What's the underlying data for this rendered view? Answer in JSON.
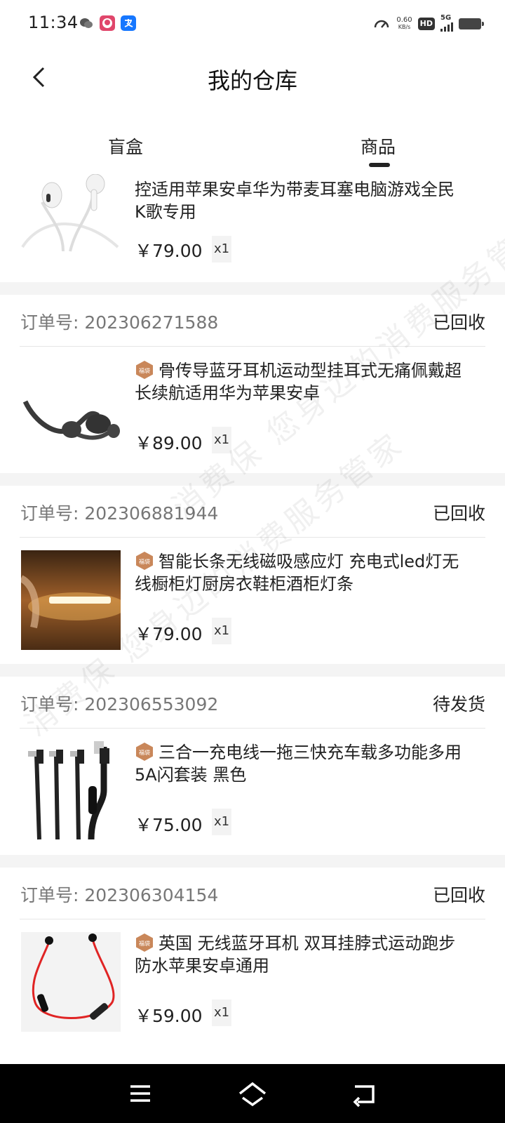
{
  "status_bar": {
    "time": "11:34",
    "net_speed_value": "0.60",
    "net_speed_unit": "KB/s",
    "hd_label": "HD",
    "signal_label": "5G"
  },
  "header": {
    "title": "我的仓库"
  },
  "tabs": [
    {
      "label": "盲盒",
      "active": false
    },
    {
      "label": "商品",
      "active": true
    }
  ],
  "orders": [
    {
      "order_label": "",
      "order_no": "",
      "status": "",
      "title": "控适用苹果安卓华为带麦耳塞电脑游戏全民K歌专用",
      "price": "￥79.00",
      "qty": "x1",
      "image": "earphones-icon",
      "tag": false
    },
    {
      "order_label": "订单号:",
      "order_no": "202306271588",
      "status": "已回收",
      "title": "骨传导蓝牙耳机运动型挂耳式无痛佩戴超长续航适用华为苹果安卓",
      "price": "￥89.00",
      "qty": "x1",
      "image": "bone-conduction-headset-icon",
      "tag": true
    },
    {
      "order_label": "订单号:",
      "order_no": "202306881944",
      "status": "已回收",
      "title": "智能长条无线磁吸感应灯 充电式led灯无线橱柜灯厨房衣鞋柜酒柜灯条",
      "price": "￥79.00",
      "qty": "x1",
      "image": "led-light-bar-icon",
      "tag": true
    },
    {
      "order_label": "订单号:",
      "order_no": "202306553092",
      "status": "待发货",
      "title": "三合一充电线一拖三快充车载多功能多用5A闪套装 黑色",
      "price": "￥75.00",
      "qty": "x1",
      "image": "charging-cable-icon",
      "tag": true
    },
    {
      "order_label": "订单号:",
      "order_no": "202306304154",
      "status": "已回收",
      "title": "英国 无线蓝牙耳机 双耳挂脖式运动跑步防水苹果安卓通用",
      "price": "￥59.00",
      "qty": "x1",
      "image": "neckband-earphones-icon",
      "tag": true
    }
  ],
  "tag_badge_text": "福袋",
  "watermark_text": "消费保 您身边的消费服务管家",
  "colors": {
    "tag": "#c9875a",
    "divider": "#e6e6e6",
    "gap": "#f4f4f4"
  }
}
